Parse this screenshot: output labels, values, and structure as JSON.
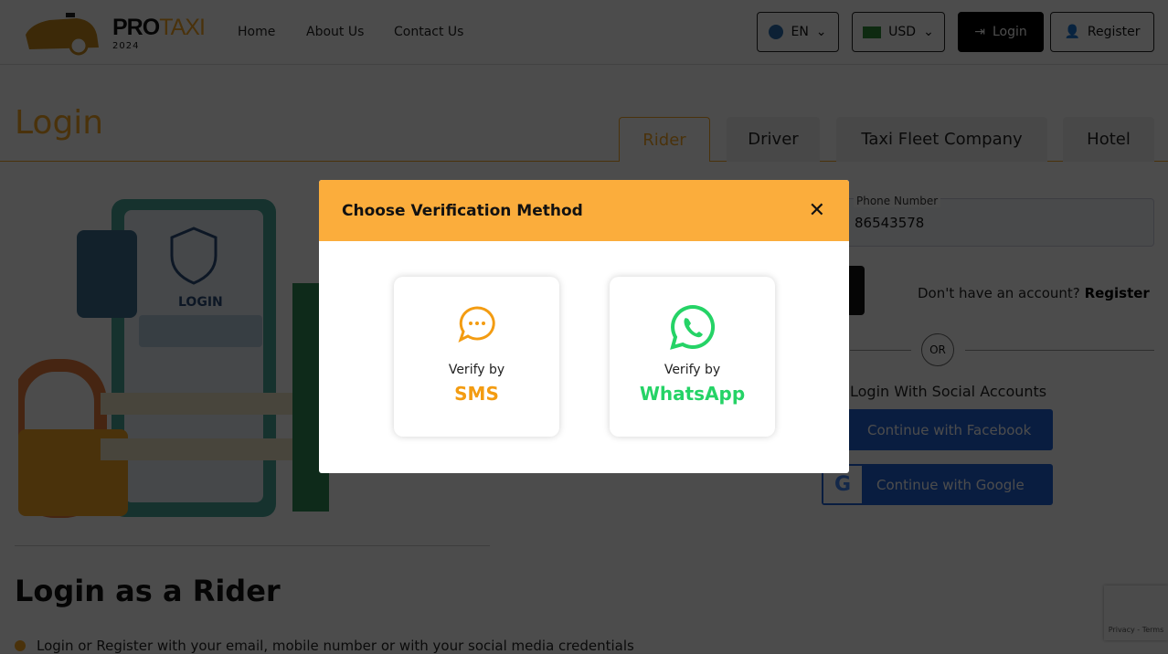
{
  "header": {
    "logo_main": "PRO",
    "logo_accent": "TAXI",
    "logo_year": "2024",
    "nav": [
      "Home",
      "About Us",
      "Contact Us"
    ],
    "language": "EN",
    "currency": "USD",
    "login": "Login",
    "register": "Register"
  },
  "page": {
    "title": "Login",
    "tabs": [
      "Rider",
      "Driver",
      "Taxi Fleet Company",
      "Hotel"
    ],
    "active_tab": "Rider"
  },
  "illustration": {
    "text": "LOGIN"
  },
  "form": {
    "phone_label": "Phone Number",
    "phone_value": "86543578",
    "no_account": "Don't have an account?",
    "register_link": "Register",
    "or": "OR",
    "social_title": "Login With Social Accounts",
    "facebook": "Continue with Facebook",
    "google": "Continue with Google"
  },
  "section": {
    "title": "Login as a Rider",
    "bullets": [
      "Login or Register with your email, mobile number  or with your social media credentials"
    ]
  },
  "recaptcha": {
    "text": "Privacy - Terms"
  },
  "modal": {
    "title": "Choose Verification Method",
    "options": [
      {
        "prefix": "Verify by",
        "method": "SMS",
        "color": "#f39c12"
      },
      {
        "prefix": "Verify by",
        "method": "WhatsApp",
        "color": "#25d366"
      }
    ]
  },
  "colors": {
    "accent": "#f5a623",
    "modal_header": "#fbad3c",
    "facebook": "#1f5fd6"
  }
}
